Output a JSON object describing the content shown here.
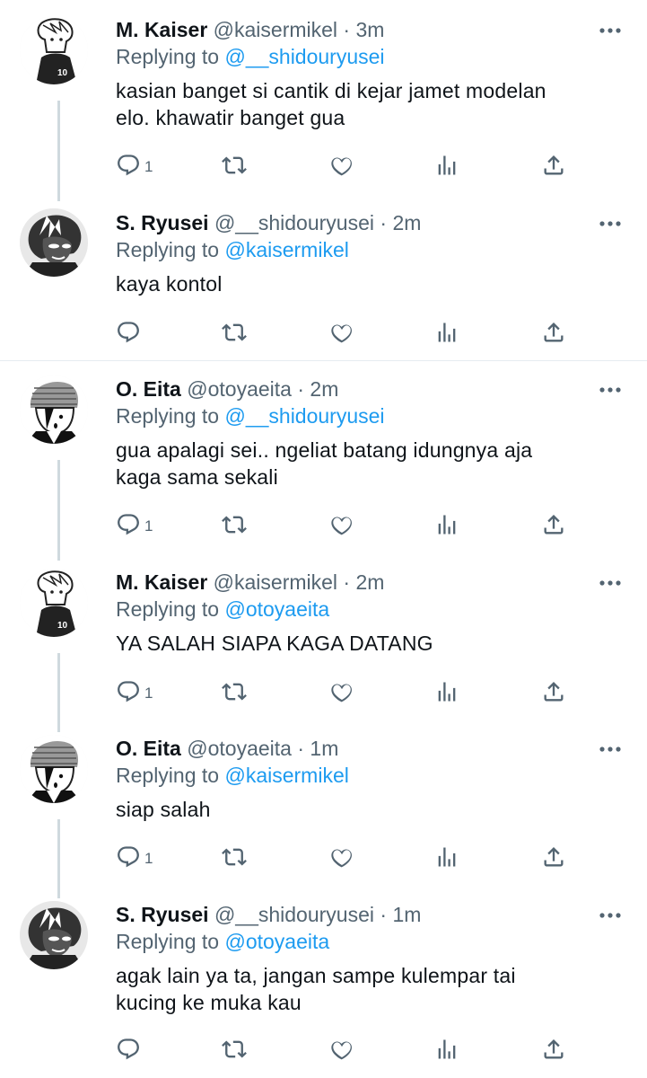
{
  "tweets": [
    {
      "name": "M. Kaiser",
      "handle": "@kaisermikel",
      "dot": "·",
      "time": "3m",
      "reply_prefix": "Replying to",
      "reply_to": "@__shidouryusei",
      "lines": [
        "kasian banget si cantik di kejar jamet modelan",
        "elo. khawatir banget gua"
      ],
      "reply_count": "1",
      "avatar": "kaiser"
    },
    {
      "name": "S. Ryusei",
      "handle": "@__shidouryusei",
      "dot": "·",
      "time": "2m",
      "reply_prefix": "Replying to",
      "reply_to": "@kaisermikel",
      "lines": [
        "kaya kontol"
      ],
      "reply_count": "",
      "avatar": "ryusei"
    },
    {
      "name": "O. Eita",
      "handle": "@otoyaeita",
      "dot": "·",
      "time": "2m",
      "reply_prefix": "Replying to",
      "reply_to": "@__shidouryusei",
      "lines": [
        "gua apalagi sei.. ngeliat batang idungnya aja",
        "kaga sama sekali"
      ],
      "reply_count": "1",
      "avatar": "eita"
    },
    {
      "name": "M. Kaiser",
      "handle": "@kaisermikel",
      "dot": "·",
      "time": "2m",
      "reply_prefix": "Replying to",
      "reply_to": "@otoyaeita",
      "lines": [
        "YA SALAH SIAPA KAGA DATANG"
      ],
      "reply_count": "1",
      "avatar": "kaiser"
    },
    {
      "name": "O. Eita",
      "handle": "@otoyaeita",
      "dot": "·",
      "time": "1m",
      "reply_prefix": "Replying to",
      "reply_to": "@kaisermikel",
      "lines": [
        "siap salah"
      ],
      "reply_count": "1",
      "avatar": "eita"
    },
    {
      "name": "S. Ryusei",
      "handle": "@__shidouryusei",
      "dot": "·",
      "time": "1m",
      "reply_prefix": "Replying to",
      "reply_to": "@otoyaeita",
      "lines": [
        "agak lain ya ta, jangan sampe kulempar tai",
        "kucing ke muka kau"
      ],
      "reply_count": "",
      "avatar": "ryusei"
    }
  ],
  "icons": {
    "reply": "reply-icon",
    "retweet": "retweet-icon",
    "like": "heart-icon",
    "views": "views-icon",
    "share": "share-icon",
    "more": "more-icon"
  },
  "colors": {
    "mention": "#1d9bf0",
    "secondary": "#536471",
    "text": "#0f1419",
    "thread_line": "#cfd9de"
  }
}
